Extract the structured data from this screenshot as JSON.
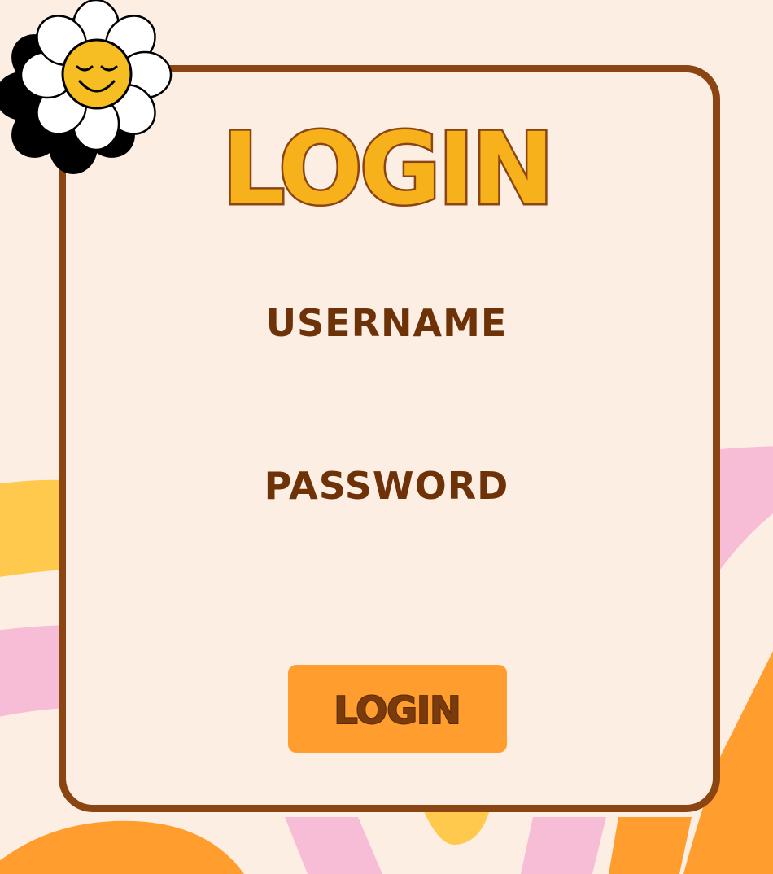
{
  "login_form": {
    "title": "LOGIN",
    "username_label": "USERNAME",
    "password_label": "PASSWORD",
    "username_value": "",
    "password_value": "",
    "submit_label": "LOGIN"
  },
  "decoration": {
    "badge_icon": "smiley-daisy-icon"
  },
  "colors": {
    "background": "#fdeee4",
    "card_border": "#8b4513",
    "title_fill": "#f7b21b",
    "title_outline": "#8b4513",
    "label_text": "#6e3209",
    "button_fill": "#ff9e2f",
    "button_text": "#6e3209",
    "arc_orange": "#ff9e2f",
    "arc_yellow": "#ffc94d",
    "arc_pink": "#f8bdd6"
  }
}
